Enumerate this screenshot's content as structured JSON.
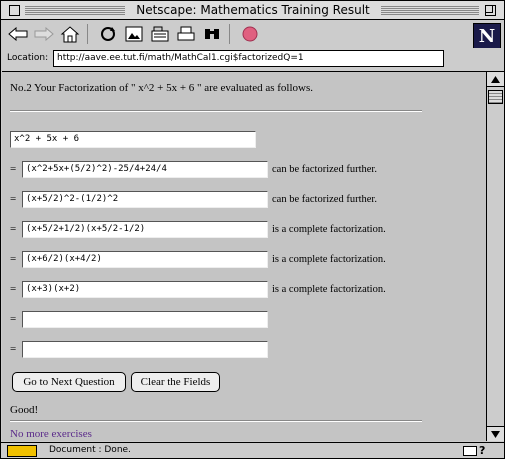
{
  "window": {
    "title": "Netscape: Mathematics Training Result"
  },
  "toolbar": {
    "buttons": [
      "back-icon",
      "forward-icon",
      "home-icon",
      "reload-icon",
      "images-icon",
      "open-icon",
      "print-icon",
      "find-icon",
      "stop-icon"
    ],
    "logo": "N"
  },
  "location": {
    "label": "Location:",
    "url": "http://aave.ee.tut.fi/math/MathCal1.cgi$factorizedQ=1"
  },
  "page": {
    "heading": "No.2 Your Factorization of \" x^2 + 5x + 6 \" are evaluated as follows.",
    "question_value": "x^2 + 5x + 6",
    "eq_sign": "=",
    "steps": [
      {
        "value": "(x^2+5x+(5/2)^2)-25/4+24/4",
        "status": "can be factorized further."
      },
      {
        "value": "(x+5/2)^2-(1/2)^2",
        "status": "can be factorized further."
      },
      {
        "value": "(x+5/2+1/2)(x+5/2-1/2)",
        "status": "is a complete factorization."
      },
      {
        "value": "(x+6/2)(x+4/2)",
        "status": "is a complete factorization."
      },
      {
        "value": "(x+3)(x+2)",
        "status": "is a complete factorization."
      },
      {
        "value": "",
        "status": ""
      },
      {
        "value": "",
        "status": ""
      }
    ],
    "next_button": "Go to Next Question",
    "clear_button": "Clear the Fields",
    "result": "Good!",
    "more_link": "No more exercises"
  },
  "statusbar": {
    "text": "Document : Done.",
    "help": "?"
  }
}
